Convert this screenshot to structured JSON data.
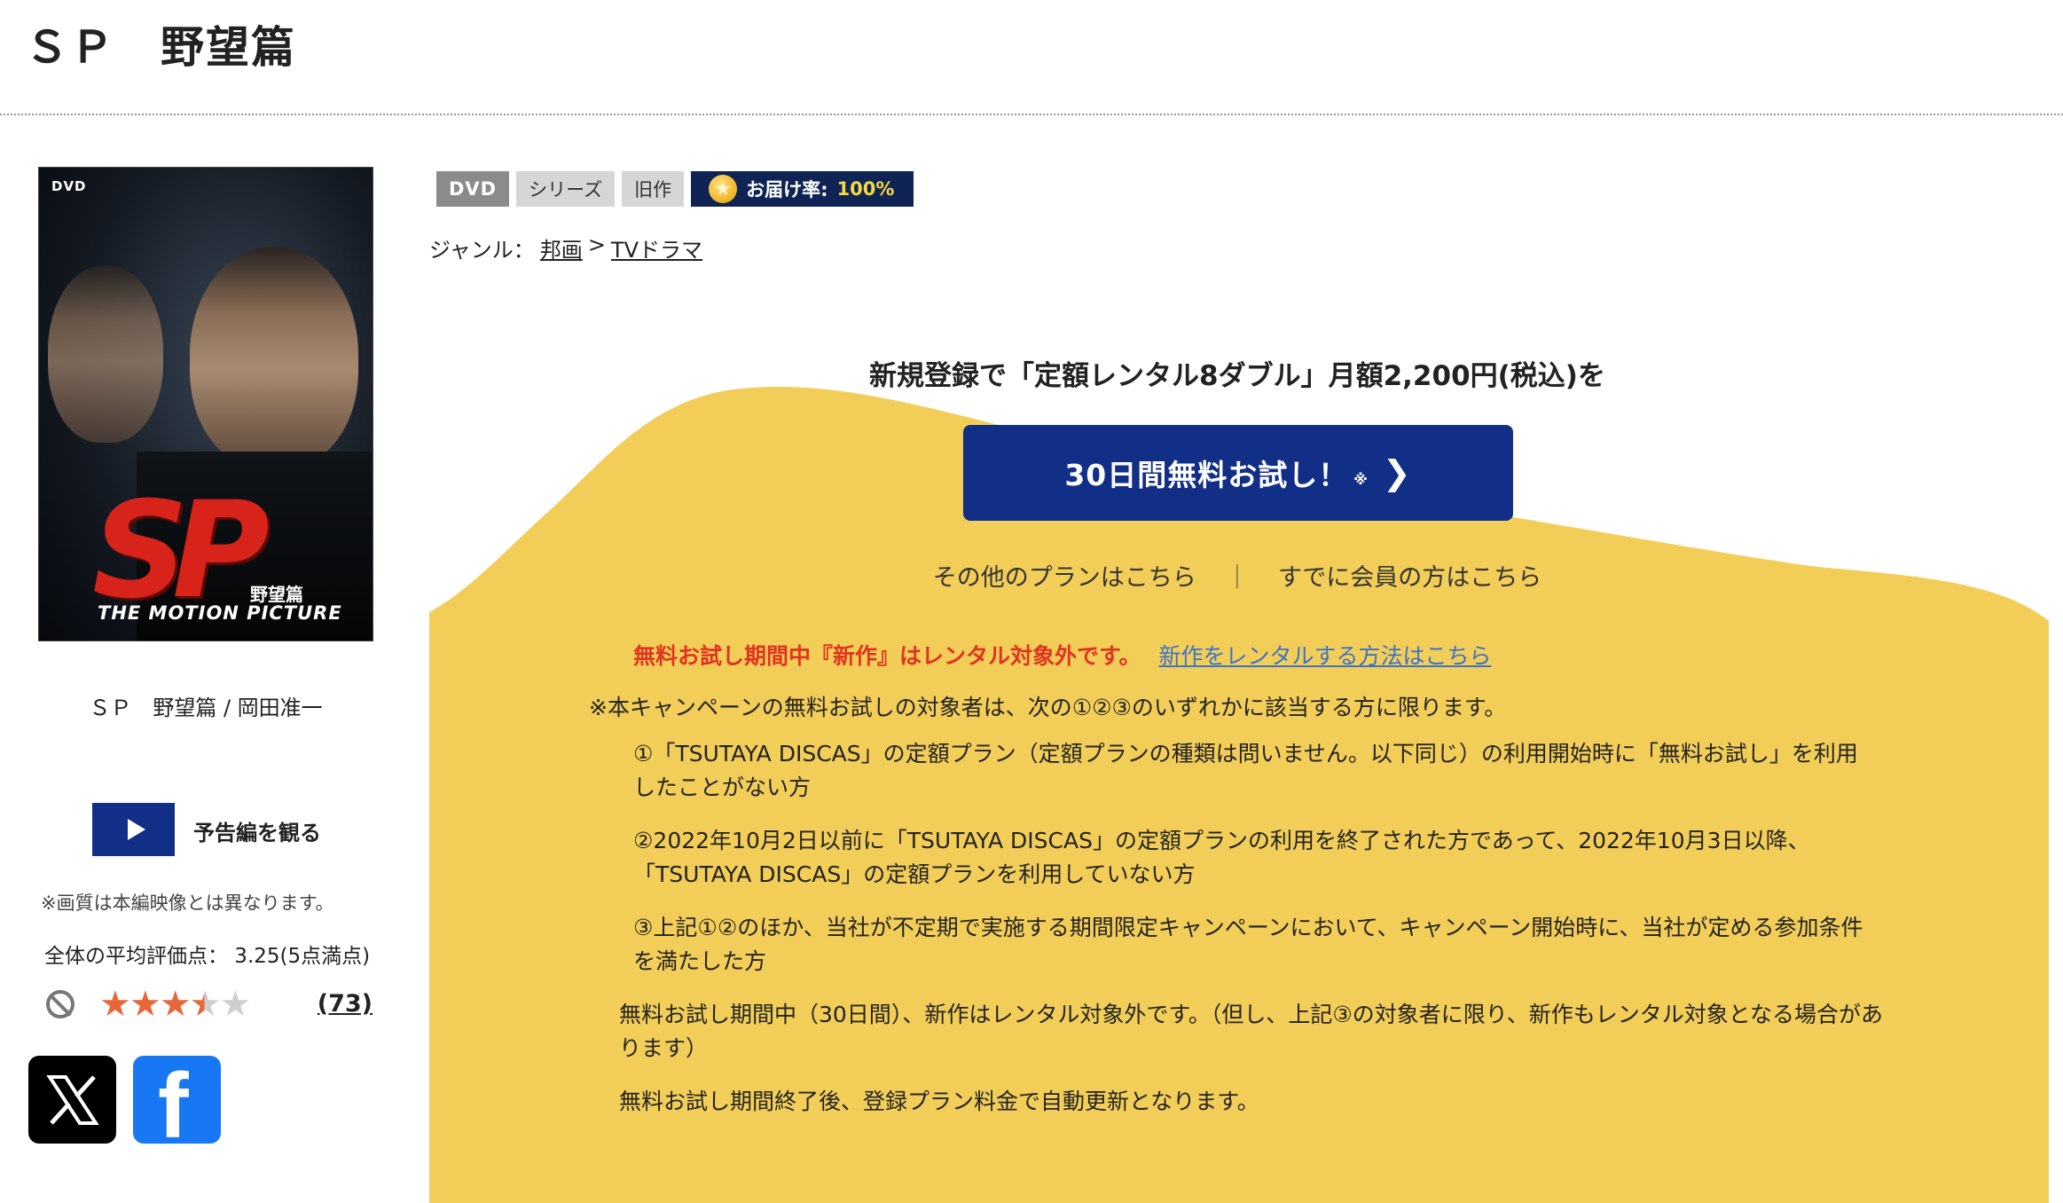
{
  "page": {
    "title": "ＳＰ　野望篇"
  },
  "cover": {
    "format_mark": "DVD",
    "logo_text": "SP",
    "subtitle": "野望篇",
    "motion_picture": "THE MOTION PICTURE"
  },
  "product": {
    "caption": "ＳＰ　野望篇 / 岡田准一"
  },
  "trailer": {
    "label": "予告編を観る"
  },
  "image_note": "※画質は本編映像とは異なります。",
  "rating": {
    "average_text": "全体の平均評価点： 3.25(5点満点)",
    "value": 3.25,
    "max": 5,
    "count": "(73)",
    "colors": {
      "filled": "#e8673a",
      "empty": "#cfcfcf"
    }
  },
  "share": {
    "x_icon": "x-logo-icon",
    "facebook_icon": "facebook-logo-icon",
    "facebook_glyph": "f"
  },
  "badges": {
    "format": "DVD",
    "series": "シリーズ",
    "old": "旧作",
    "delivery_label": "お届け率:",
    "delivery_rate": "100%"
  },
  "genre": {
    "label": "ジャンル：",
    "category": "邦画",
    "separator": ">",
    "subcategory": "TVドラマ"
  },
  "promo": {
    "headline": "新規登録で「定額レンタル8ダブル」月額2,200円(税込)を",
    "cta_label": "30日間無料お試し！",
    "cta_mark": "※",
    "cta_chevron": "❯",
    "other_plans": "その他のプランはこちら",
    "separator": "｜",
    "member_link": "すでに会員の方はこちら",
    "notice_red": "無料お試し期間中『新作』はレンタル対象外です。",
    "notice_link": "新作をレンタルする方法はこちら",
    "terms_lead": "※本キャンペーンの無料お試しの対象者は、次の①②③のいずれかに該当する方に限ります。",
    "terms_items": [
      "①「TSUTAYA DISCAS」の定額プラン（定額プランの種類は問いません。以下同じ）の利用開始時に「無料お試し」を利用したことがない方",
      "②2022年10月2日以前に「TSUTAYA DISCAS」の定額プランの利用を終了された方であって、2022年10月3日以降、「TSUTAYA DISCAS」の定額プランを利用していない方",
      "③上記①②のほか、当社が不定期で実施する期間限定キャンペーンにおいて、キャンペーン開始時に、当社が定める参加条件を満たした方"
    ],
    "para1": "無料お試し期間中（30日間）、新作はレンタル対象外です。（但し、上記③の対象者に限り、新作もレンタル対象となる場合があります）",
    "para2": "無料お試し期間終了後、登録プラン料金で自動更新となります。",
    "colors": {
      "background": "#f2cd57",
      "button": "#112f86",
      "notice": "#e03522",
      "link": "#3d74c8"
    }
  }
}
